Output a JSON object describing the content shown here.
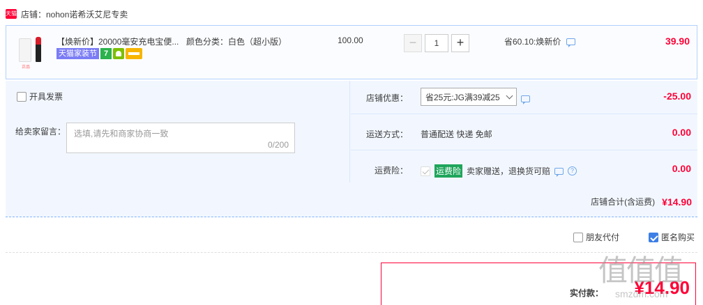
{
  "store": {
    "tag": "天猫",
    "name": "店铺：nohon诺希沃艾尼专卖"
  },
  "item": {
    "title": "【焕新价】20000毫安充电宝便...",
    "attr": "颜色分类：白色（超小版）",
    "thumb_text": "正品",
    "badges": {
      "festival": "天猫家装节",
      "seven": "7"
    },
    "unit_price": "100.00",
    "quantity": "1",
    "minus": "−",
    "plus": "+",
    "discount": "省60.10:焕新价",
    "total": "39.90"
  },
  "options": {
    "invoice_label": "开具发票",
    "message_label": "给卖家留言：",
    "message_placeholder": "选填,请先和商家协商一致",
    "message_count": "0/200",
    "coupon": {
      "label": "店铺优惠：",
      "selected": "省25元:JG满39减25",
      "amount": "-25.00"
    },
    "shipping": {
      "label": "运送方式：",
      "value": "普通配送 快递 免邮",
      "amount": "0.00"
    },
    "insurance": {
      "label": "运费险：",
      "tag": "运费险",
      "value": "卖家赠送，退换货可赔",
      "help": "?",
      "amount": "0.00"
    }
  },
  "store_sum": {
    "label": "店铺合计(含运费)",
    "amount": "¥14.90"
  },
  "footer": {
    "friend_pay": "朋友代付",
    "anonymous": "匿名购买",
    "pay_label": "实付款：",
    "pay_amount": "¥14.90",
    "watermark": "值值值",
    "watermark_sub": "smzdm.com"
  },
  "colors": {
    "accent": "#ff0036",
    "border": "#b2d1ff",
    "panel": "#f2f7ff"
  }
}
